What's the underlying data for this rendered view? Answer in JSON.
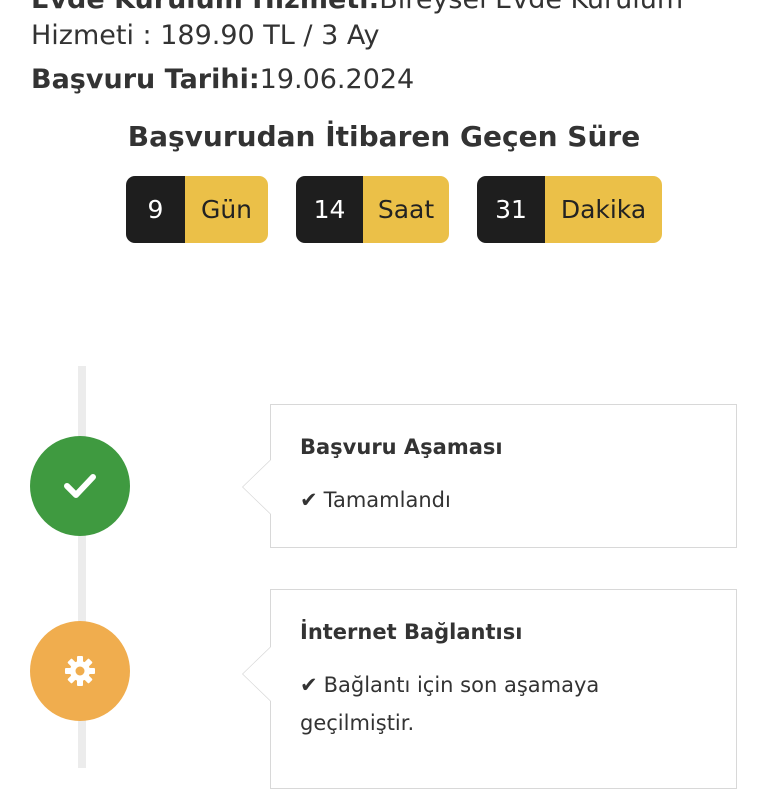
{
  "application": {
    "service_label": "Evde Kurulum Hizmeti:",
    "service_value": "Bireysel Evde Kurulum",
    "service_value_cont": "Hizmeti : 189.90 TL / 3 Ay",
    "date_label": "Başvuru Tarihi:",
    "date_value": "19.06.2024"
  },
  "elapsed": {
    "title": "Başvurudan İtibaren Geçen Süre",
    "counters": [
      {
        "value": "9",
        "unit": "Gün"
      },
      {
        "value": "14",
        "unit": "Saat"
      },
      {
        "value": "31",
        "unit": "Dakika"
      }
    ]
  },
  "timeline": {
    "steps": [
      {
        "title": "Başvuru Aşaması",
        "check": "✔",
        "status": "Tamamlandı",
        "icon": "check-icon",
        "color": "#3f9a40"
      },
      {
        "title": "İnternet Bağlantısı",
        "check": "✔",
        "status": "Bağlantı için son aşamaya geçilmiştir.",
        "icon": "gear-icon",
        "color": "#f0ad4e"
      }
    ]
  },
  "colors": {
    "counter_number_bg": "#1e1e1e",
    "counter_unit_bg": "#ebc048"
  }
}
